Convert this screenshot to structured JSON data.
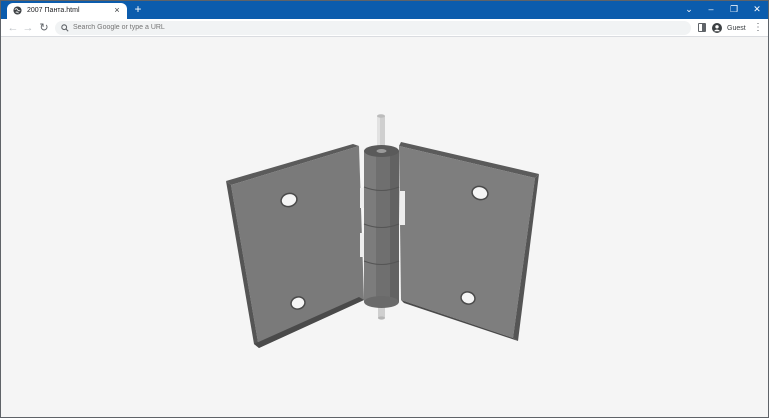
{
  "tab": {
    "title": "2007 Панта.html",
    "close_glyph": "×",
    "favicon": "globe-icon"
  },
  "tabstrip": {
    "new_tab_glyph": "+",
    "background": "#0b5cad"
  },
  "window_controls": {
    "search_tabs_glyph": "⌄",
    "minimize_glyph": "–",
    "restore_glyph": "❐",
    "close_glyph": "✕"
  },
  "toolbar": {
    "back_glyph": "←",
    "forward_glyph": "→",
    "reload_glyph": "↻",
    "omnibox_placeholder": "Search Google or type a URL",
    "profile_label": "Guest",
    "menu_glyph": "⋮"
  },
  "scene": {
    "subject": "3D door hinge",
    "leaf_color": "#7a7a7a",
    "pin_color": "#cfcfcf",
    "background": "#f5f5f5"
  }
}
